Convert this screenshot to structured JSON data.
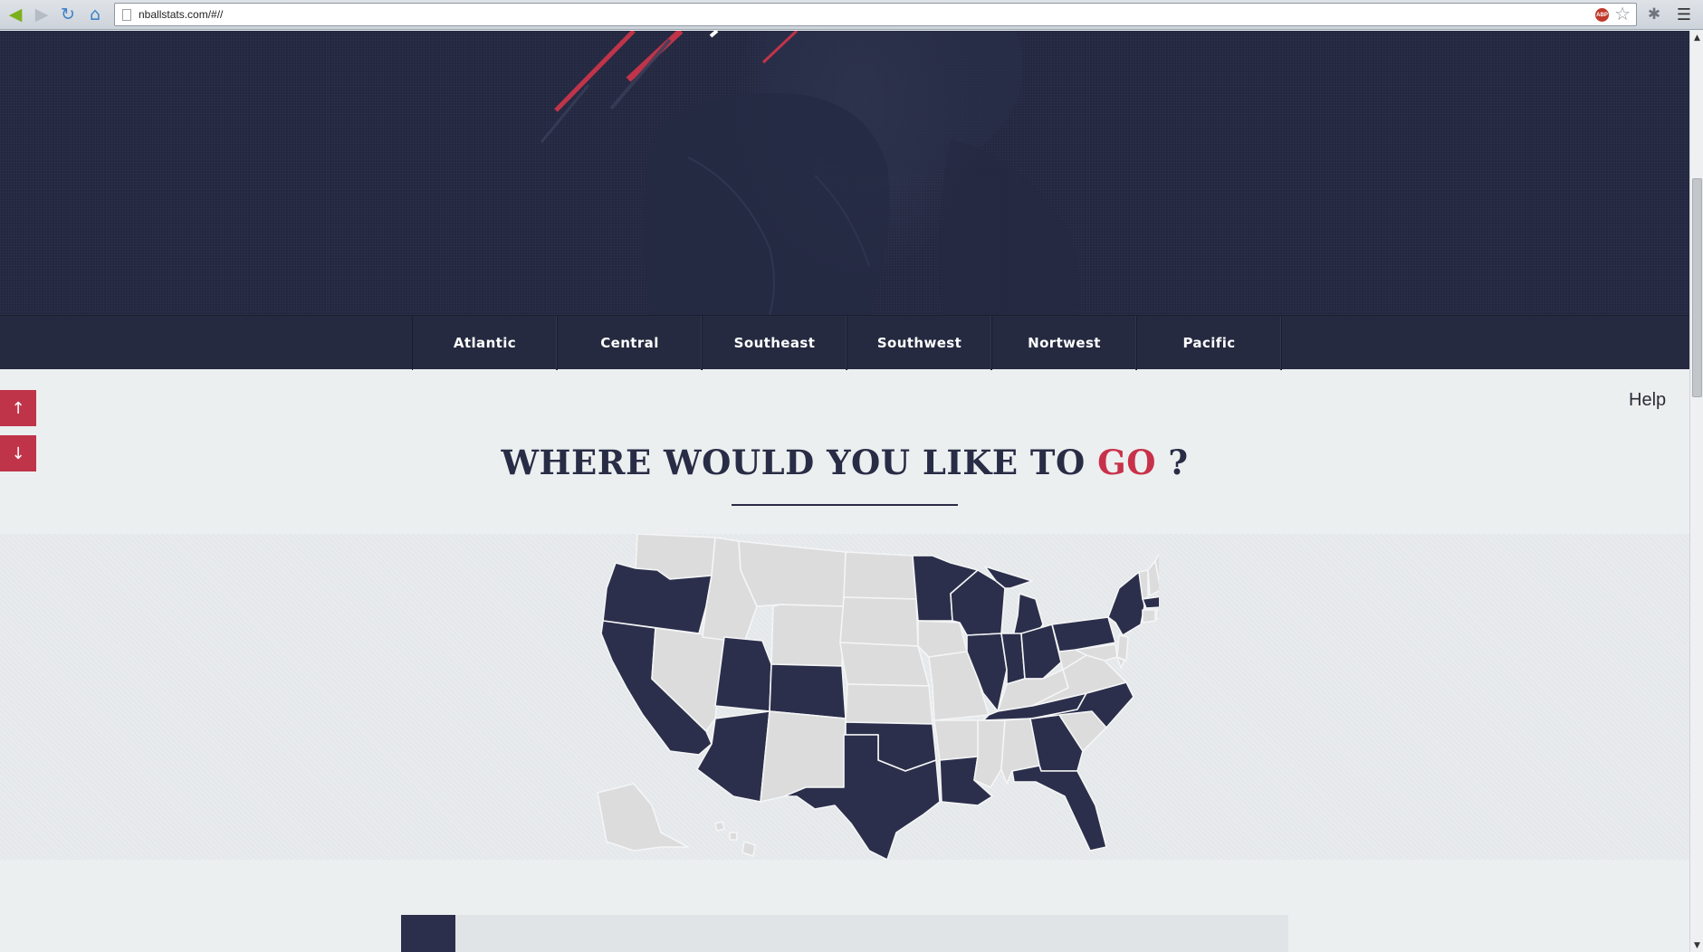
{
  "browser": {
    "url": "nballstats.com/#//"
  },
  "divisions": {
    "tabs": [
      "Atlantic",
      "Central",
      "Southeast",
      "Southwest",
      "Nortwest",
      "Pacific"
    ]
  },
  "help_label": "Help",
  "heading": {
    "text": "WHERE WOULD YOU LIKE TO ",
    "accent": "GO",
    "suffix": " ?"
  },
  "colors": {
    "navy": "#232840",
    "nav_bar": "#252a40",
    "accent_red": "#c0344a",
    "state_with_team": "#2c2f4b",
    "state_without_team": "#dcdcdd"
  },
  "map": {
    "highlighted_states": [
      "Oregon",
      "California",
      "Utah",
      "Arizona",
      "Colorado",
      "Texas",
      "Oklahoma",
      "Louisiana",
      "Minnesota",
      "Wisconsin",
      "Illinois",
      "Michigan",
      "Indiana",
      "Ohio",
      "Tennessee",
      "Georgia",
      "Florida",
      "North Carolina",
      "Pennsylvania",
      "New York",
      "Massachusetts"
    ]
  }
}
